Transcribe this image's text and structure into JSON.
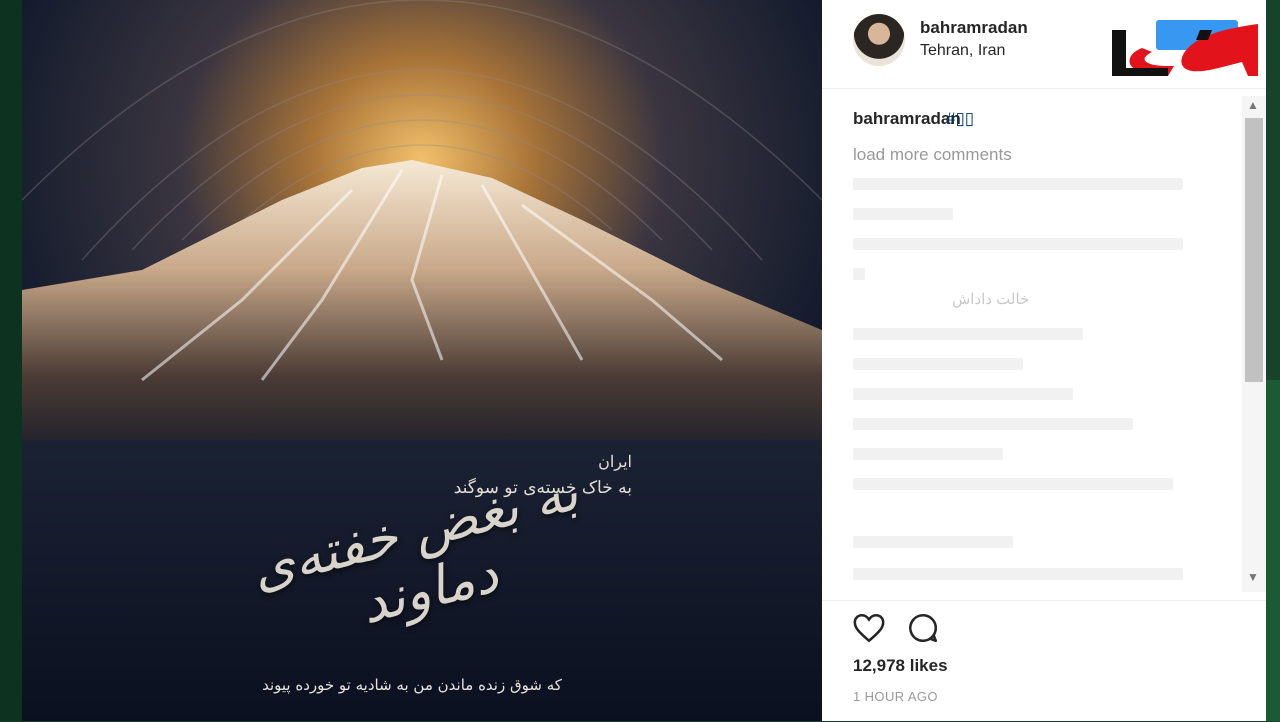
{
  "post": {
    "poster_title": "به بغض خفته‌ی دماوند",
    "poster_subtitle_1": "ایران",
    "poster_subtitle_2": "به خاک خسته‌ی تو سوگند",
    "poster_verse": "که شوق زنده ماندن من به شادیه تو خورده پیوند"
  },
  "header": {
    "username": "bahramradan",
    "location": "Tehran, Iran",
    "follow_label": ""
  },
  "caption": {
    "username": "bahramradan",
    "tag": "#▯▯"
  },
  "comments": {
    "load_more": "load more comments",
    "faded_fragments": [
      "خالت داداش"
    ]
  },
  "actions": {
    "likes": "12,978 likes",
    "timestamp": "1 HOUR AGO"
  },
  "colors": {
    "accent": "#3897f0",
    "logo_red": "#e3131b"
  },
  "icons": {
    "like": "heart-icon",
    "comment": "comment-icon",
    "logo": "logo-watermark"
  }
}
